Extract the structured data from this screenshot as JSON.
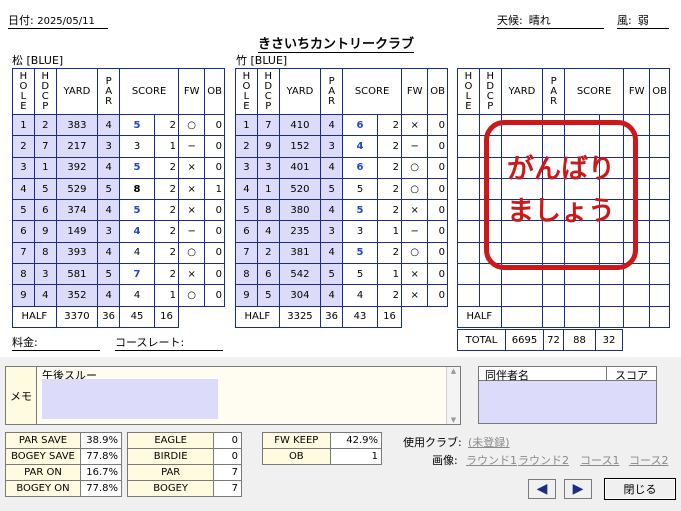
{
  "header": {
    "date_label": "日付:",
    "date_value": "2025/05/11",
    "course_name": "きさいちカントリークラブ",
    "weather_label": "天候:",
    "weather_value": "晴れ",
    "wind_label": "風:",
    "wind_value": "弱"
  },
  "columns": [
    "YARD",
    "SCORE",
    "FW",
    "OB"
  ],
  "vertical_cols": {
    "hole": [
      "H",
      "O",
      "L",
      "E"
    ],
    "hdcp": [
      "H",
      "D",
      "C",
      "P"
    ],
    "par": [
      "P",
      "A",
      "R"
    ]
  },
  "front": {
    "label": "松 [BLUE]",
    "rows": [
      {
        "hole": "1",
        "hdcp": "2",
        "yard": "383",
        "par": "4",
        "score": "5",
        "putt": "2",
        "fw": "○",
        "ob": "0"
      },
      {
        "hole": "2",
        "hdcp": "7",
        "yard": "217",
        "par": "3",
        "score": "3",
        "putt": "1",
        "fw": "−",
        "ob": "0"
      },
      {
        "hole": "3",
        "hdcp": "1",
        "yard": "392",
        "par": "4",
        "score": "5",
        "putt": "2",
        "fw": "×",
        "ob": "0"
      },
      {
        "hole": "4",
        "hdcp": "5",
        "yard": "529",
        "par": "5",
        "score": "8",
        "putt": "2",
        "fw": "×",
        "ob": "1"
      },
      {
        "hole": "5",
        "hdcp": "6",
        "yard": "374",
        "par": "4",
        "score": "5",
        "putt": "2",
        "fw": "×",
        "ob": "0"
      },
      {
        "hole": "6",
        "hdcp": "9",
        "yard": "149",
        "par": "3",
        "score": "4",
        "putt": "2",
        "fw": "−",
        "ob": "0"
      },
      {
        "hole": "7",
        "hdcp": "8",
        "yard": "393",
        "par": "4",
        "score": "4",
        "putt": "2",
        "fw": "○",
        "ob": "0"
      },
      {
        "hole": "8",
        "hdcp": "3",
        "yard": "581",
        "par": "5",
        "score": "7",
        "putt": "2",
        "fw": "×",
        "ob": "0"
      },
      {
        "hole": "9",
        "hdcp": "4",
        "yard": "352",
        "par": "4",
        "score": "4",
        "putt": "1",
        "fw": "○",
        "ob": "0"
      }
    ],
    "half": {
      "label": "HALF",
      "yard": "3370",
      "par": "36",
      "score": "45",
      "putt": "16"
    }
  },
  "back": {
    "label": "竹 [BLUE]",
    "rows": [
      {
        "hole": "1",
        "hdcp": "7",
        "yard": "410",
        "par": "4",
        "score": "6",
        "putt": "2",
        "fw": "×",
        "ob": "0"
      },
      {
        "hole": "2",
        "hdcp": "9",
        "yard": "152",
        "par": "3",
        "score": "4",
        "putt": "2",
        "fw": "−",
        "ob": "0"
      },
      {
        "hole": "3",
        "hdcp": "3",
        "yard": "401",
        "par": "4",
        "score": "6",
        "putt": "2",
        "fw": "○",
        "ob": "0"
      },
      {
        "hole": "4",
        "hdcp": "1",
        "yard": "520",
        "par": "5",
        "score": "5",
        "putt": "2",
        "fw": "○",
        "ob": "0"
      },
      {
        "hole": "5",
        "hdcp": "8",
        "yard": "380",
        "par": "4",
        "score": "5",
        "putt": "2",
        "fw": "×",
        "ob": "0"
      },
      {
        "hole": "6",
        "hdcp": "4",
        "yard": "235",
        "par": "3",
        "score": "3",
        "putt": "1",
        "fw": "−",
        "ob": "0"
      },
      {
        "hole": "7",
        "hdcp": "2",
        "yard": "381",
        "par": "4",
        "score": "5",
        "putt": "2",
        "fw": "○",
        "ob": "0"
      },
      {
        "hole": "8",
        "hdcp": "6",
        "yard": "542",
        "par": "5",
        "score": "5",
        "putt": "1",
        "fw": "×",
        "ob": "0"
      },
      {
        "hole": "9",
        "hdcp": "5",
        "yard": "304",
        "par": "4",
        "score": "4",
        "putt": "2",
        "fw": "×",
        "ob": "0"
      }
    ],
    "half": {
      "label": "HALF",
      "yard": "3325",
      "par": "36",
      "score": "43",
      "putt": "16"
    }
  },
  "third": {
    "half_label": "HALF",
    "stamp_line1": "がんばり",
    "stamp_line2": "ましょう"
  },
  "total": {
    "label": "TOTAL",
    "yard": "6695",
    "par": "72",
    "score": "88",
    "putt": "32"
  },
  "fee_label": "料金:",
  "course_rate_label": "コースレート:",
  "memo": {
    "label": "メモ",
    "text": "午後スルー"
  },
  "stats1": [
    {
      "label": "PAR SAVE",
      "value": "38.9%"
    },
    {
      "label": "BOGEY SAVE",
      "value": "77.8%"
    },
    {
      "label": "PAR ON",
      "value": "16.7%"
    },
    {
      "label": "BOGEY ON",
      "value": "77.8%"
    }
  ],
  "stats2": [
    {
      "label": "EAGLE",
      "value": "0"
    },
    {
      "label": "BIRDIE",
      "value": "0"
    },
    {
      "label": "PAR",
      "value": "7"
    },
    {
      "label": "BOGEY",
      "value": "7"
    }
  ],
  "stats3": [
    {
      "label": "FW KEEP",
      "value": "42.9%"
    },
    {
      "label": "OB",
      "value": "1"
    }
  ],
  "companion": {
    "name_header": "同伴者名",
    "score_header": "スコア"
  },
  "club": {
    "label": "使用クラブ:",
    "value": "(未登録)"
  },
  "images": {
    "label": "画像:",
    "links": [
      "ラウンド1",
      "ラウンド2",
      "コース1",
      "コース2"
    ]
  },
  "buttons": {
    "prev": "◀",
    "next": "▶",
    "close": "閉じる"
  },
  "colors": {
    "frame": "#1a2c8c",
    "birdie_blue": "#1f48c8",
    "highlight": "#dcdcfa",
    "stamp": "#cc1818"
  }
}
